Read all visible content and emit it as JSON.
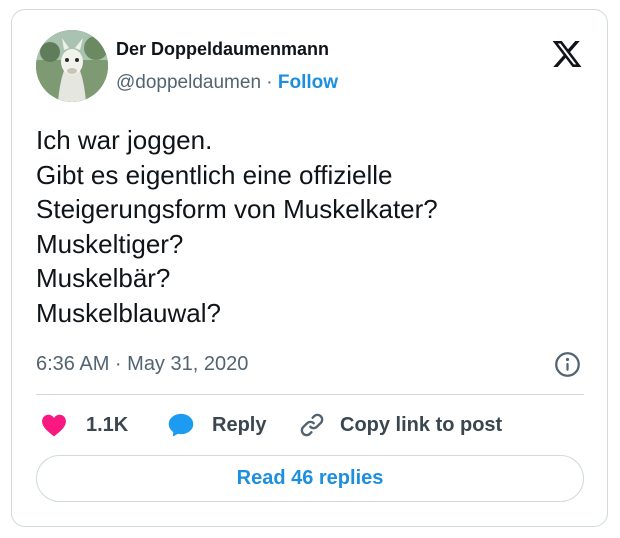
{
  "author": {
    "display_name": "Der Doppeldaumenmann",
    "handle": "@doppeldaumen",
    "separator": "·",
    "follow_label": "Follow"
  },
  "tweet": {
    "lines": [
      "Ich war joggen.",
      "Gibt es eigentlich eine offizielle",
      "Steigerungsform von Muskelkater?",
      "Muskeltiger?",
      "Muskelbär?",
      "Muskelblauwal?"
    ],
    "timestamp": "6:36 AM · May 31, 2020"
  },
  "actions": {
    "like_count": "1.1K",
    "reply_label": "Reply",
    "copy_label": "Copy link to post"
  },
  "read_replies_label": "Read 46 replies",
  "icons": {
    "logo": "x-logo-icon",
    "info": "info-icon",
    "like": "heart-icon",
    "reply": "speech-bubble-icon",
    "copy": "link-icon"
  },
  "colors": {
    "link_blue": "#1d8fe0",
    "heart_pink": "#f91880",
    "reply_blue": "#1d9bf0",
    "muted_text": "#536471",
    "border": "#cfd9de"
  }
}
